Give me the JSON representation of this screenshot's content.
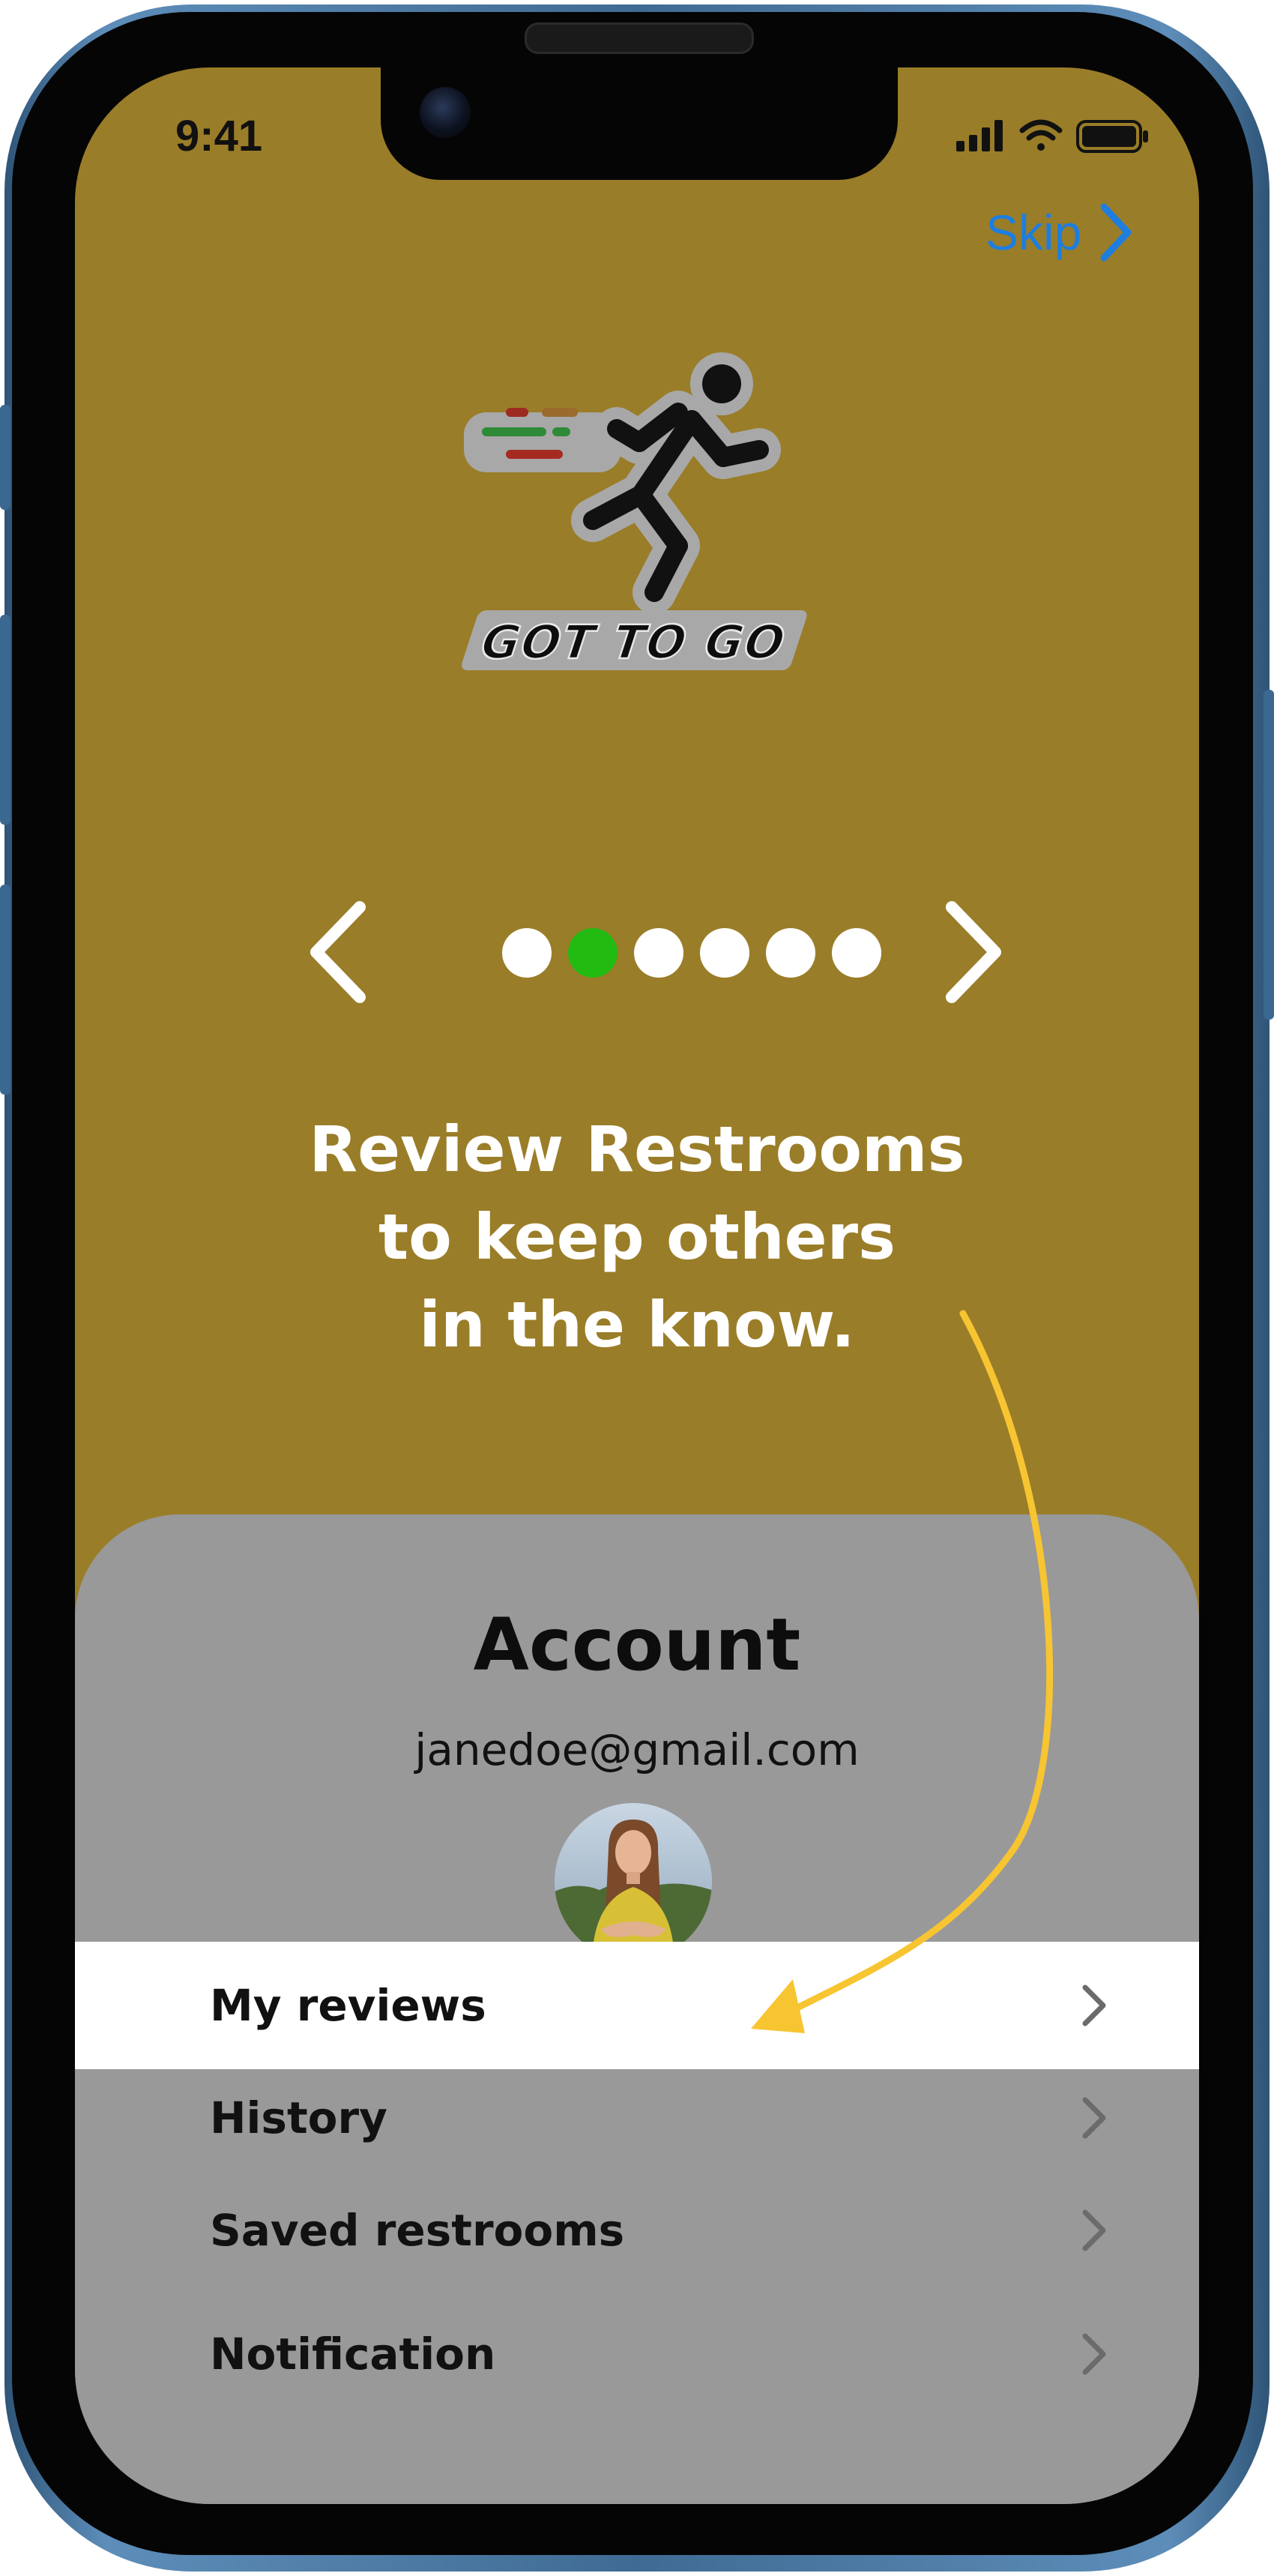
{
  "status_bar": {
    "time": "9:41"
  },
  "onboarding": {
    "skip_label": "Skip",
    "logo_text": "GOT TO GO",
    "carousel": {
      "total_pages": 6,
      "active_page": 2
    },
    "headline_lines": [
      "Review Restrooms",
      "to keep others",
      "in the know."
    ]
  },
  "account": {
    "title": "Account",
    "email": "janedoe@gmail.com",
    "menu": [
      {
        "label": "My reviews",
        "highlighted": true
      },
      {
        "label": "History",
        "highlighted": false
      },
      {
        "label": "Saved restrooms",
        "highlighted": false
      },
      {
        "label": "Notification",
        "highlighted": false
      }
    ]
  },
  "colors": {
    "screen_background": "#9a7d28",
    "card_background": "#999999",
    "active_dot": "#22bb11",
    "skip_accent": "#1d7ee0",
    "annotation_arrow": "#f7c531",
    "phone_frame": "#4a7aa5"
  },
  "icons": {
    "skip": "chevron-right-icon",
    "carousel_prev": "chevron-left-icon",
    "carousel_next": "chevron-right-icon",
    "menu_row": "chevron-right-icon",
    "signal": "cellular-signal-icon",
    "wifi": "wifi-icon",
    "battery": "battery-icon"
  }
}
